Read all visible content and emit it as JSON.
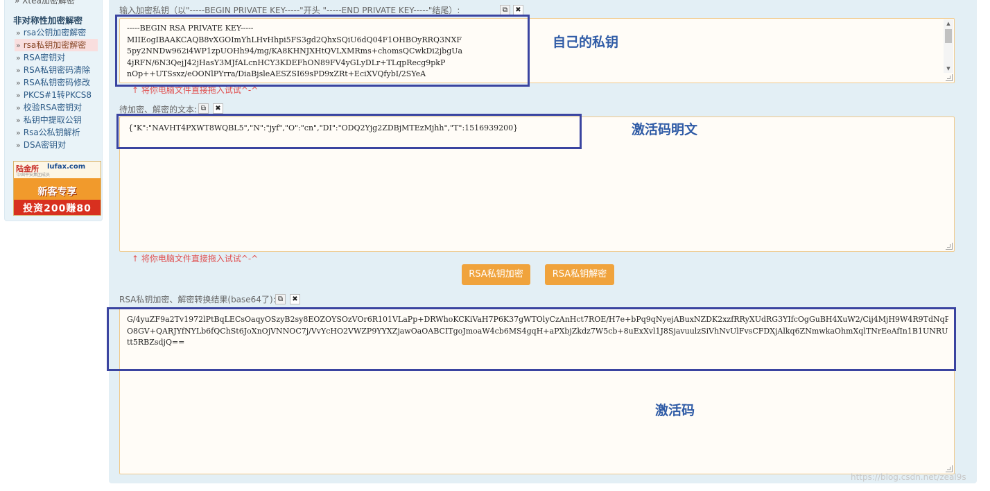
{
  "sidebar": {
    "top_partial": "» Xtea加密解密",
    "section_title": "非对称性加密解密",
    "items": [
      {
        "label": "rsa公钥加密解密",
        "active": false
      },
      {
        "label": "rsa私钥加密解密",
        "active": true
      },
      {
        "label": "RSA密钥对",
        "active": false
      },
      {
        "label": "RSA私钥密码清除",
        "active": false
      },
      {
        "label": "RSA私钥密码修改",
        "active": false
      },
      {
        "label": "PKCS#1转PKCS8",
        "active": false
      },
      {
        "label": "校验RSA密钥对",
        "active": false
      },
      {
        "label": "私钥中提取公钥",
        "active": false
      },
      {
        "label": "Rsa公私钥解析",
        "active": false
      },
      {
        "label": "DSA密钥对",
        "active": false
      }
    ],
    "bullet": "»",
    "ad": {
      "logo": "陆金所",
      "logo_en": "lufax.com",
      "sub": "中国平安集团成员",
      "title": "新客专享",
      "bottom": "投资200赚80"
    }
  },
  "main": {
    "key_label": "输入加密私钥（以\"-----BEGIN PRIVATE KEY-----\"开头 \"-----END PRIVATE KEY-----\"结尾）:",
    "key_text": "-----BEGIN RSA PRIVATE KEY-----\nMIIEogIBAAKCAQB8vXGOImYhLHvHhpi5FS3gd2QhxSQiU6dQ04F1OHBOyRRQ3NXF\n5py2NNDw962i4WP1zpUOHh94/mg/KA8KHNJXHtQVLXMRms+chomsQCwkDi2jbgUa\n4jRFN/6N3QejJ42jHasY3MJfALcnHCY3KDEFhON89FV4yGLyDLr+TLqpRecg9pkP\nnOp++UTSsxz/eOONlPYrra/DiaBjsleAESZSI69sPD9xZRt+EciXVQfybI/2SYeA",
    "key_hint": "↑ 将你电脑文件直接拖入试试^-^",
    "plain_label": "待加密、解密的文本:",
    "plain_text": "{\"K\":\"NAVHT4PXWT8WQBL5\",\"N\":\"jyf\",\"O\":\"cn\",\"DI\":\"ODQ2Yjg2ZDBjMTEzMjhh\",\"T\":1516939200}",
    "plain_hint": "↑ 将你电脑文件直接拖入试试^-^",
    "encrypt_button": "RSA私钥加密",
    "decrypt_button": "RSA私钥解密",
    "result_label": "RSA私钥加密、解密转换结果(base64了):",
    "result_text": "G/4yuZF9a2Tv1972lPtBqLECsOaqyOSzyB2sy8EOZOYSOzVOr6R101VLaPp+DRWhoKCKiVaH7P6K37gWTOlyCzAnHct7ROE/H7e+bPq9qNyejABuxNZDK2xzfRRyXUdRG3YIfcOgGuBH4XuW2/Cij4MjH9W4R9TdNqP/Jz\nO8GV+QARJYfNYLb6fQChSt6JoXnOjVNNOC7j/VvYcHO2VWZP9YYXZjawOaOABCITgoJmoaW4cb6MS4gqH+aPXbjZkdz7W5cb+8uExXvl1J8SjavuulzSiVhNvUlFvsCFDXjAlkq6ZNmwkaOhmXqlTNrEeAfIn1B1UNRU06\ntt5RBZsdjQ==",
    "copy_icon": "⧉",
    "clear_icon": "✖"
  },
  "annotations": {
    "private_key": "自己的私钥",
    "plaintext": "激活码明文",
    "activation_code": "激活码"
  },
  "watermark": "https://blog.csdn.net/zeal9s",
  "colors": {
    "panel_bg": "#e3eff5",
    "button_bg": "#f0a33c",
    "box_border": "#3a44a0",
    "annotation_text": "#2f5ba6",
    "hint_text": "#e05050"
  }
}
